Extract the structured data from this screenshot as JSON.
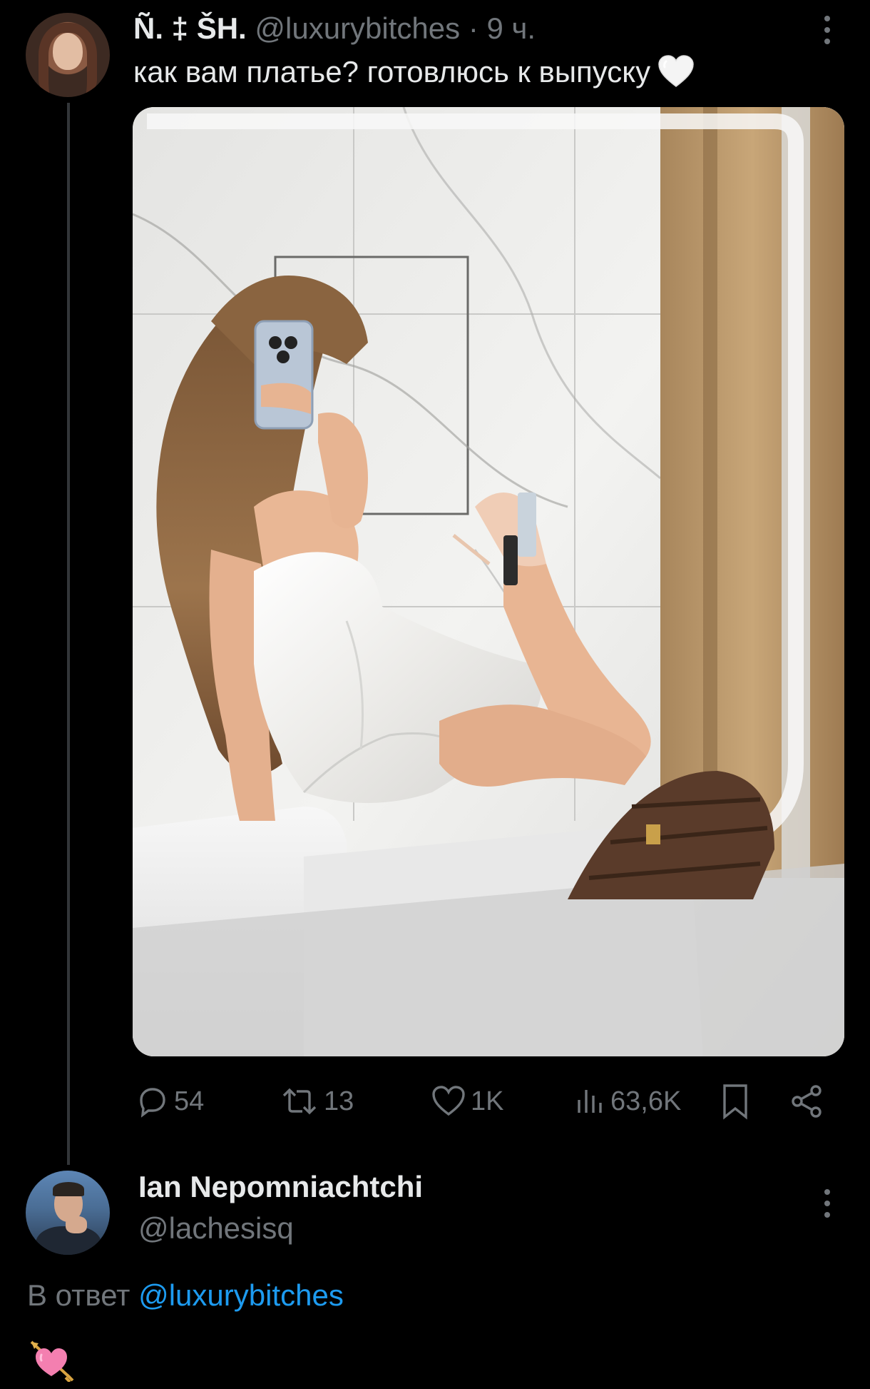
{
  "tweet": {
    "author": {
      "display_name": "Ñ. ‡ ŠH.",
      "handle": "@luxurybitches",
      "separator": "·",
      "time": "9 ч."
    },
    "text": "как вам платье? готовлюсь к выпуску",
    "text_emoji": "white-heart",
    "photo": "mirror-selfie-white-dress",
    "stats": {
      "replies": "54",
      "retweets": "13",
      "likes": "1K",
      "views": "63,6K"
    }
  },
  "reply": {
    "author": {
      "display_name": "Ian Nepomniachtchi",
      "handle": "@lachesisq"
    },
    "reply_to_prefix": "В ответ",
    "reply_to_handle": "@luxurybitches",
    "emoji": "heart-with-arrow"
  },
  "colors": {
    "background": "#000000",
    "primary_text": "#e7e9ea",
    "secondary_text": "#71767b",
    "link": "#1d9bf0",
    "thread_line": "#333639"
  },
  "icons": {
    "reply": "reply-bubble-icon",
    "retweet": "retweet-icon",
    "like": "heart-outline-icon",
    "views": "views-bars-icon",
    "bookmark": "bookmark-icon",
    "share": "share-icon",
    "more": "more-vertical-icon"
  }
}
